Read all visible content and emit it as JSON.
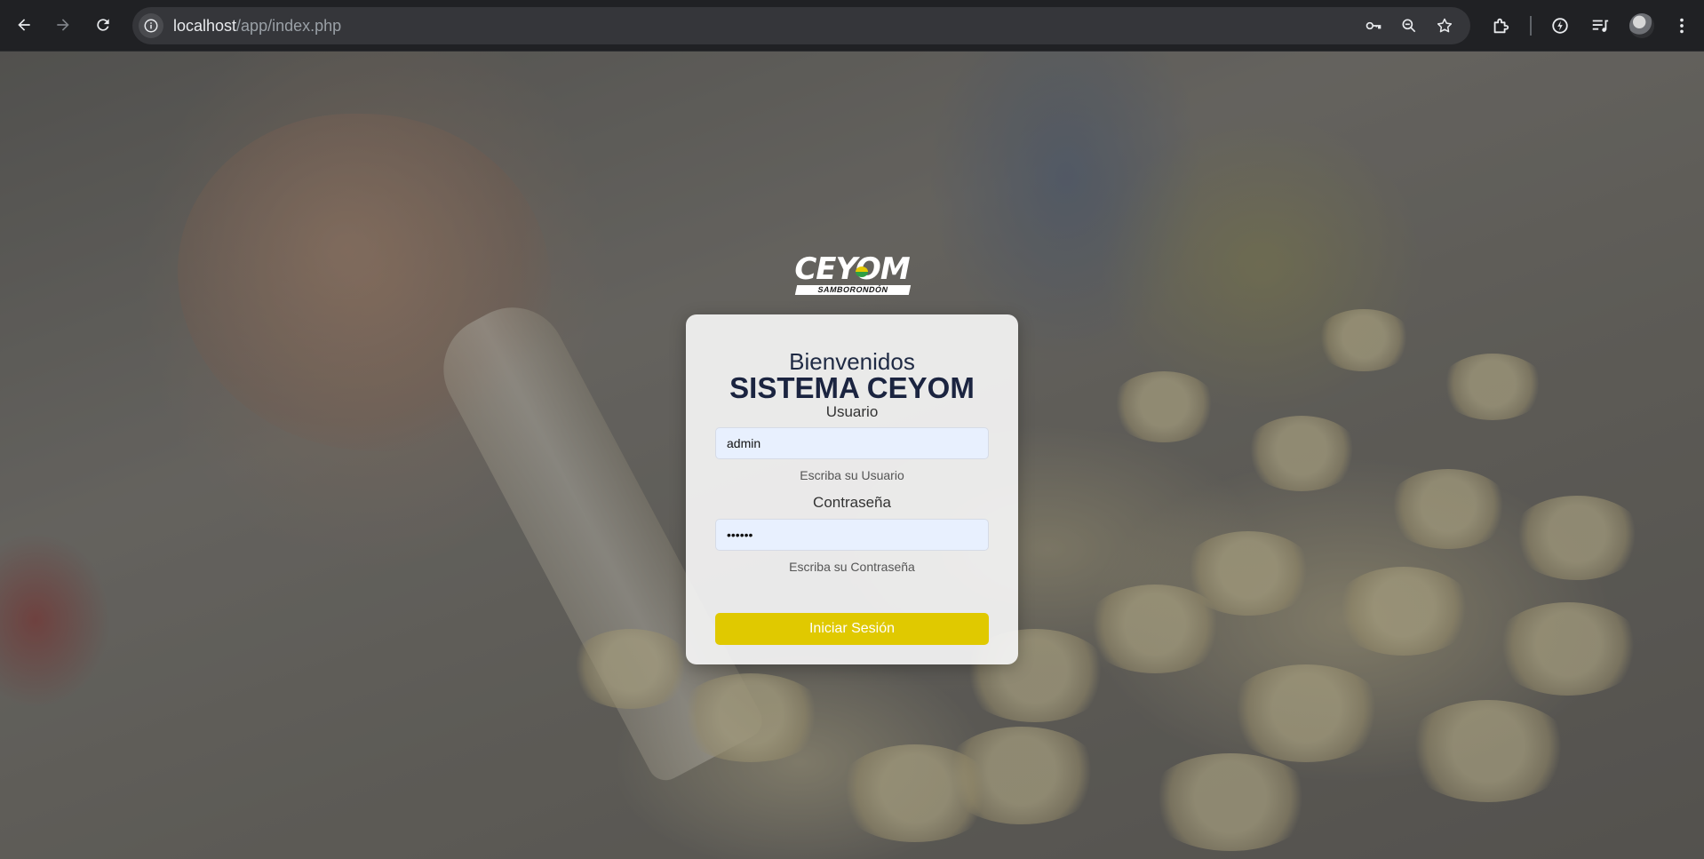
{
  "browser": {
    "url_host": "localhost",
    "url_path": "/app/index.php"
  },
  "logo": {
    "name": "CEYOM",
    "subtitle": "SAMBORONDÓN"
  },
  "login": {
    "welcome": "Bienvenidos",
    "system_title": "SISTEMA CEYOM",
    "username_label": "Usuario",
    "username_value": "admin",
    "username_help": "Escriba su Usuario",
    "password_label": "Contraseña",
    "password_value": "123456",
    "password_help": "Escriba su Contraseña",
    "submit_label": "Iniciar Sesión"
  },
  "colors": {
    "button": "#e0c900",
    "title": "#1b2440",
    "input_bg": "#e8f0fe"
  }
}
